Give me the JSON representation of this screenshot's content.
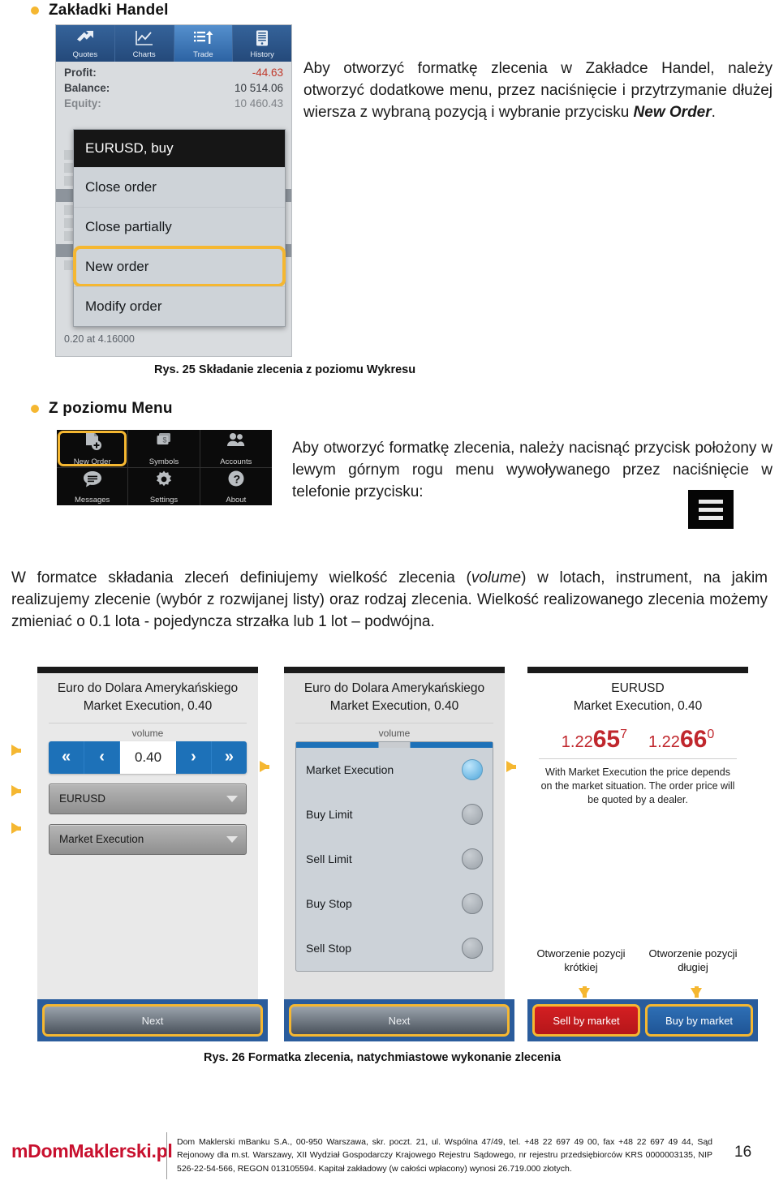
{
  "section1": {
    "heading": "Zakładki Handel",
    "paragraph_parts": {
      "before": "Aby otworzyć formatkę zlecenia w Zakładce Handel, należy otworzyć dodatkowe menu, przez naciśnięcie i przytrzymanie dłużej wiersza z wybraną pozycją i wybranie przycisku ",
      "bold": "New Order",
      "after": "."
    },
    "caption": "Rys. 25 Składanie zlecenia z poziomu Wykresu"
  },
  "mt4": {
    "tabs": [
      {
        "label": "Quotes",
        "icon": "quotes-arrows-icon",
        "active": false
      },
      {
        "label": "Charts",
        "icon": "line-chart-icon",
        "active": false
      },
      {
        "label": "Trade",
        "icon": "trade-list-icon",
        "active": true
      },
      {
        "label": "History",
        "icon": "history-device-icon",
        "active": false
      }
    ],
    "account_rows": [
      {
        "key": "Profit:",
        "value": "-44.63",
        "negative": true
      },
      {
        "key": "Balance:",
        "value": "10 514.06",
        "negative": false
      },
      {
        "key": "Equity:",
        "value": "10 460.43",
        "negative": false
      }
    ],
    "bottom_note": "0.20 at 4.16000",
    "context_menu": {
      "title": "EURUSD, buy",
      "items": [
        {
          "label": "Close order",
          "highlighted": false
        },
        {
          "label": "Close partially",
          "highlighted": false
        },
        {
          "label": "New order",
          "highlighted": true
        },
        {
          "label": "Modify order",
          "highlighted": false
        }
      ]
    }
  },
  "section2": {
    "heading": "Z poziomu Menu",
    "paragraph": "Aby otworzyć formatkę zlecenia, należy nacisnąć przycisk położony w lewym górnym rogu menu wywoływanego przez naciśnięcie w telefonie przycisku:",
    "menu_tiles": [
      {
        "label": "New Order",
        "icon": "new-order-page-icon",
        "highlighted": true
      },
      {
        "label": "Symbols",
        "icon": "symbols-money-icon",
        "highlighted": false
      },
      {
        "label": "Accounts",
        "icon": "accounts-people-icon",
        "highlighted": false
      },
      {
        "label": "Messages",
        "icon": "messages-bubble-icon",
        "highlighted": false
      },
      {
        "label": "Settings",
        "icon": "settings-gear-icon",
        "highlighted": false
      },
      {
        "label": "About",
        "icon": "about-question-icon",
        "highlighted": false
      }
    ],
    "menu_button_icon": "hamburger-menu-icon"
  },
  "body_paragraph": {
    "p1": "W formatce składania zleceń definiujemy wielkość zlecenia (",
    "italic": "volume",
    "p2": ") w lotach, instrument, na jakim realizujemy zlecenie (wybór z rozwijanej listy) oraz rodzaj zlecenia. Wielkość realizowanego zlecenia możemy zmieniać o 0.1 lota - pojedyncza strzałka lub 1 lot – podwójna."
  },
  "figure26": {
    "caption": "Rys. 26 Formatka zlecenia, natychmiastowe wykonanie zlecenia",
    "panel1": {
      "title_line1": "Euro do Dolara Amerykańskiego",
      "title_line2": "Market Execution, 0.40",
      "volume_label": "volume",
      "stepper": {
        "dec_big": "«",
        "dec_small": "‹",
        "value": "0.40",
        "inc_small": "›",
        "inc_big": "»"
      },
      "symbol_select": "EURUSD",
      "type_select": "Market Execution",
      "next_button": "Next"
    },
    "panel2": {
      "title_line1": "Euro do Dolara Amerykańskiego",
      "title_line2": "Market Execution, 0.40",
      "volume_label": "volume",
      "options": [
        {
          "label": "Market Execution",
          "selected": true
        },
        {
          "label": "Buy Limit",
          "selected": false
        },
        {
          "label": "Sell Limit",
          "selected": false
        },
        {
          "label": "Buy Stop",
          "selected": false
        },
        {
          "label": "Sell Stop",
          "selected": false
        }
      ],
      "next_button": "Next"
    },
    "panel3": {
      "title_line1": "EURUSD",
      "title_line2": "Market Execution, 0.40",
      "bid": {
        "int": "1.22",
        "big": "65",
        "sup": "7"
      },
      "ask": {
        "int": "1.22",
        "big": "66",
        "sup": "0"
      },
      "note": "With Market Execution the price depends on the market situation. The order price will be quoted by a dealer.",
      "sell_label_line1": "Otworzenie pozycji",
      "sell_label_line2": "krótkiej",
      "buy_label_line1": "Otworzenie pozycji",
      "buy_label_line2": "długiej",
      "sell_button": "Sell by market",
      "buy_button": "Buy by market"
    }
  },
  "footer": {
    "logo": "mDomMaklerski.pl",
    "text": "Dom Maklerski mBanku S.A., 00-950 Warszawa, skr. poczt. 21, ul. Wspólna 47/49, tel. +48 22 697 49 00, fax +48 22 697 49 44, Sąd Rejonowy dla m.st. Warszawy, XII Wydział Gospodarczy Krajowego Rejestru Sądowego, nr rejestru przedsiębiorców KRS 0000003135, NIP 526-22-54-566, REGON 013105594. Kapitał zakładowy (w całości wpłacony) wynosi 26.719.000 złotych.",
    "page_number": "16"
  },
  "colors": {
    "accent_yellow": "#f5b731",
    "mt4_blue": "#2e5c90",
    "sell_red": "#d41f22",
    "buy_blue": "#2e6fb5",
    "price_red": "#c0272d",
    "logo_red": "#c8102e"
  }
}
